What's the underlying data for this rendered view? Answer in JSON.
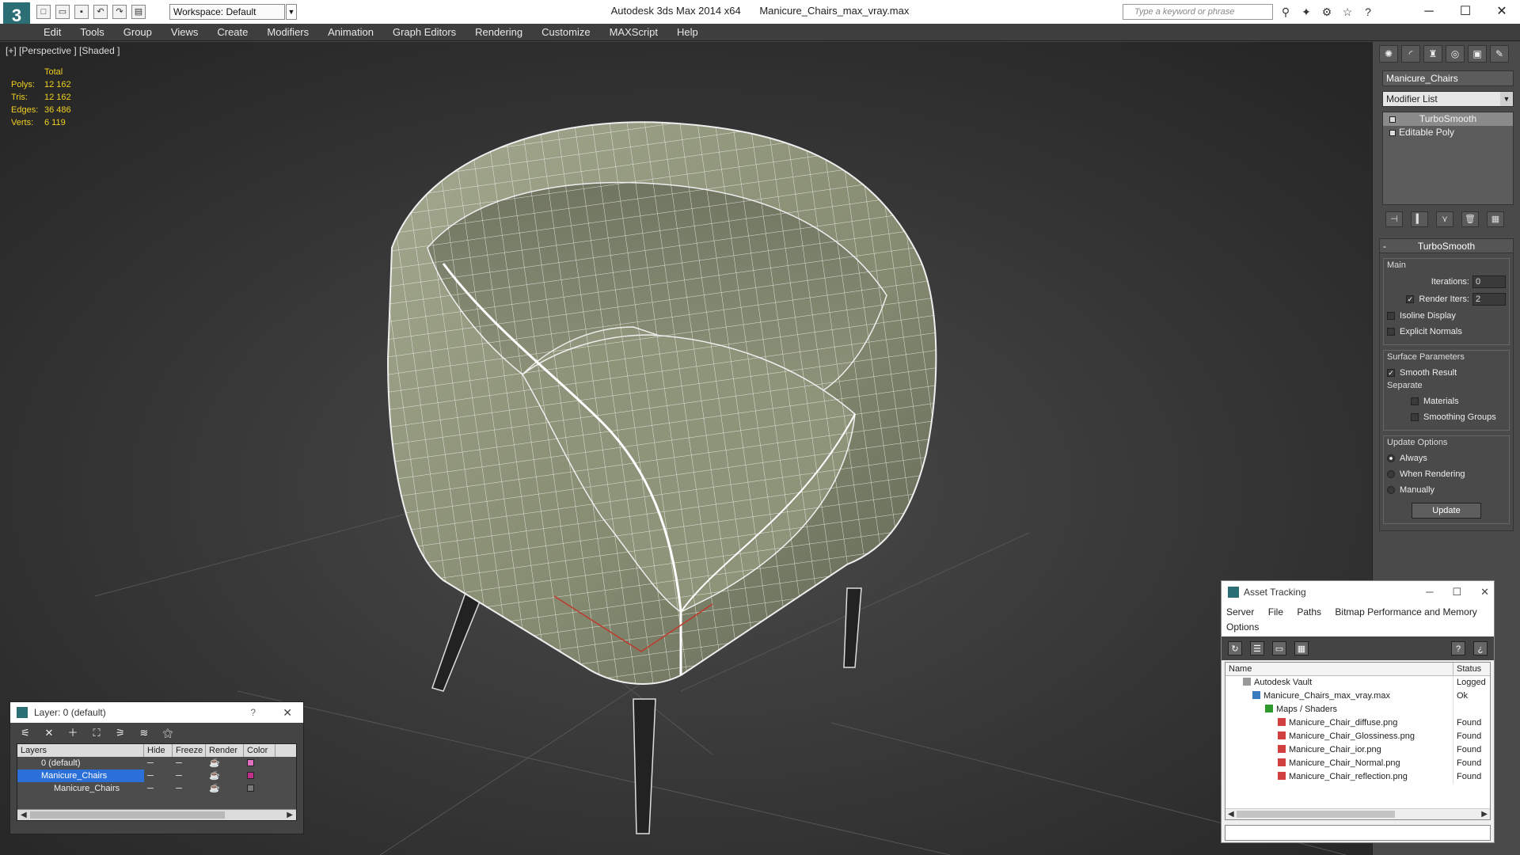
{
  "app": {
    "name": "Autodesk 3ds Max  2014 x64",
    "file": "Manicure_Chairs_max_vray.max",
    "workspace": "Workspace: Default",
    "search_placeholder": "Type a keyword or phrase"
  },
  "menu": [
    "Edit",
    "Tools",
    "Group",
    "Views",
    "Create",
    "Modifiers",
    "Animation",
    "Graph Editors",
    "Rendering",
    "Customize",
    "MAXScript",
    "Help"
  ],
  "viewport": {
    "label": "[+] [Perspective ] [Shaded ]",
    "stats": {
      "header": "Total",
      "rows": [
        {
          "k": "Polys:",
          "v": "12 162"
        },
        {
          "k": "Tris:",
          "v": "12 162"
        },
        {
          "k": "Edges:",
          "v": "36 486"
        },
        {
          "k": "Verts:",
          "v": "6 119"
        }
      ]
    }
  },
  "command_panel": {
    "object_name": "Manicure_Chairs",
    "modifier_list": "Modifier List",
    "stack": [
      "TurboSmooth",
      "Editable Poly"
    ],
    "rollout": {
      "title": "TurboSmooth",
      "main_label": "Main",
      "iterations_label": "Iterations:",
      "iterations_value": "0",
      "render_iters_label": "Render Iters:",
      "render_iters_value": "2",
      "isoline": "Isoline Display",
      "explicit": "Explicit Normals",
      "surface_label": "Surface Parameters",
      "smooth_result": "Smooth Result",
      "separate_label": "Separate",
      "materials": "Materials",
      "smoothing_groups": "Smoothing Groups",
      "update_label": "Update Options",
      "always": "Always",
      "when_rendering": "When Rendering",
      "manually": "Manually",
      "update_button": "Update"
    }
  },
  "layer_window": {
    "title": "Layer: 0 (default)",
    "help": "?",
    "columns": [
      "Layers",
      "Hide",
      "Freeze",
      "Render",
      "Color"
    ],
    "rows": [
      {
        "name": "0 (default)",
        "color": "#e070c0"
      },
      {
        "name": "Manicure_Chairs",
        "color": "#c0308a"
      },
      {
        "name": "Manicure_Chairs",
        "color": "#777777"
      }
    ]
  },
  "asset_window": {
    "title": "Asset Tracking",
    "menu": [
      "Server",
      "File",
      "Paths",
      "Bitmap Performance and Memory",
      "Options"
    ],
    "columns": [
      "Name",
      "Status"
    ],
    "rows": [
      {
        "name": "Autodesk Vault",
        "status": "Logged",
        "indent": 1
      },
      {
        "name": "Manicure_Chairs_max_vray.max",
        "status": "Ok",
        "indent": 2
      },
      {
        "name": "Maps / Shaders",
        "status": "",
        "indent": 3
      },
      {
        "name": "Manicure_Chair_diffuse.png",
        "status": "Found",
        "indent": 4
      },
      {
        "name": "Manicure_Chair_Glossiness.png",
        "status": "Found",
        "indent": 4
      },
      {
        "name": "Manicure_Chair_ior.png",
        "status": "Found",
        "indent": 4
      },
      {
        "name": "Manicure_Chair_Normal.png",
        "status": "Found",
        "indent": 4
      },
      {
        "name": "Manicure_Chair_reflection.png",
        "status": "Found",
        "indent": 4
      }
    ]
  }
}
